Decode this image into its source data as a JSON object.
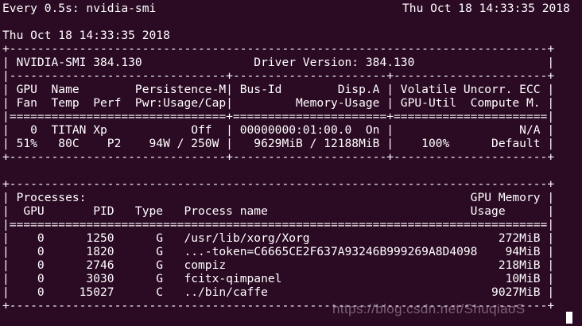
{
  "header": {
    "command": "Every 0.5s: nvidia-smi",
    "clock": "Thu Oct 18 14:33:35 2018",
    "timestamp": "Thu Oct 18 14:33:35 2018"
  },
  "gpu_table": {
    "rows": [
      "+-----------------------------------------------------------------------------+",
      "| NVIDIA-SMI 384.130                Driver Version: 384.130                   |",
      "|-------------------------------+----------------------+----------------------+",
      "| GPU  Name        Persistence-M| Bus-Id        Disp.A | Volatile Uncorr. ECC |",
      "| Fan  Temp  Perf  Pwr:Usage/Cap|         Memory-Usage | GPU-Util  Compute M. |",
      "|===============================+======================+======================|",
      "|   0  TITAN Xp            Off  | 00000000:01:00.0  On |                  N/A |",
      "| 51%   80C    P2    94W / 250W |   9629MiB / 12188MiB |    100%      Default |",
      "+-------------------------------+----------------------+----------------------+"
    ]
  },
  "process_table": {
    "rows": [
      "+-----------------------------------------------------------------------------+",
      "| Processes:                                                       GPU Memory |",
      "|  GPU       PID   Type   Process name                             Usage      |",
      "|=============================================================================|",
      "|    0      1250      G   /usr/lib/xorg/Xorg                           272MiB |",
      "|    0      1820      G   ...-token=C6665CE2F637A93246B999269A8D4098    94MiB |",
      "|    0      2746      G   compiz                                       218MiB |",
      "|    0      3030      G   fcitx-qimpanel                                10MiB |",
      "|    0     15027      C   ../bin/caffe                                9027MiB |",
      "+-----------------------------------------------------------------------------+"
    ]
  },
  "watermark": "https://blog.csdn.net/ShuqiaoS"
}
